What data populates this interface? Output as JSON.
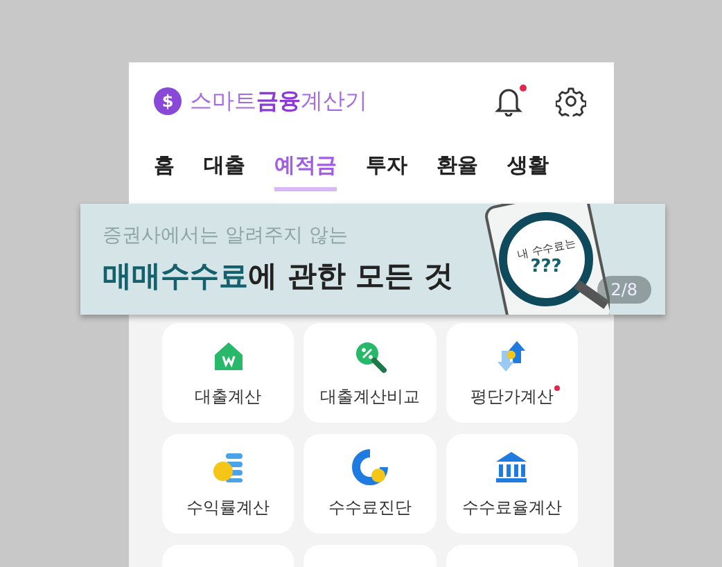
{
  "app_header": {
    "logo_symbol": "$",
    "title": "스마트**금융**계산기",
    "notification": true
  },
  "tabs": [
    {
      "label": "홈",
      "selected": false
    },
    {
      "label": "대출",
      "selected": false
    },
    {
      "label": "예적금",
      "selected": true
    },
    {
      "label": "투자",
      "selected": false
    },
    {
      "label": "환율",
      "selected": false
    },
    {
      "label": "생활",
      "selected": false
    }
  ],
  "banner": {
    "subtitle": "증권사에서는 알려주지 않는",
    "headline_highlight": "매매수수료",
    "headline_rest": "에 관한 모든 것",
    "illustration_caption": "내 수수료는",
    "illustration_value": "???",
    "pager": "2/8"
  },
  "tiles": [
    {
      "kind": "full",
      "label": "대출계산",
      "badge": false
    },
    {
      "kind": "full",
      "label": "대출계산비교",
      "badge": false
    },
    {
      "kind": "full",
      "label": "평단가계산",
      "badge": true
    },
    {
      "kind": "full",
      "label": "수익률계산",
      "badge": false
    },
    {
      "kind": "full",
      "label": "수수료진단",
      "badge": false
    },
    {
      "kind": "full",
      "label": "수수료율계산",
      "badge": false
    },
    {
      "kind": "partial"
    },
    {
      "kind": "partial"
    },
    {
      "kind": "partial"
    }
  ]
}
